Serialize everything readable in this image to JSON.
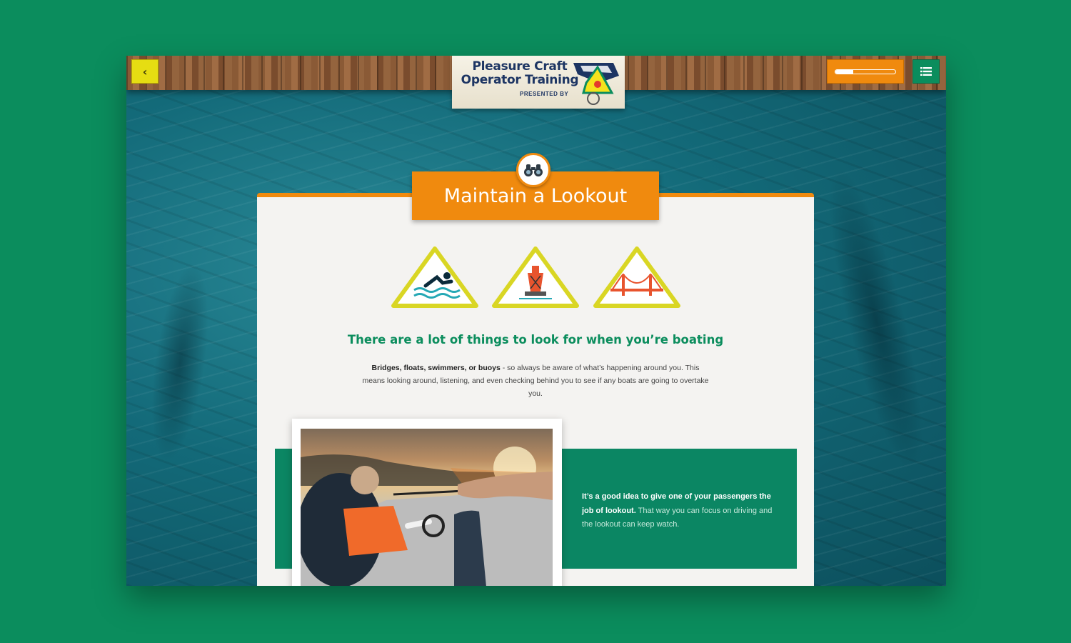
{
  "header": {
    "back_button": "‹",
    "logo_title_line1": "Pleasure Craft",
    "logo_title_line2": "Operator Training",
    "logo_presented_by": "PRESENTED BY",
    "progress": 0.3
  },
  "lesson": {
    "title": "Maintain a Lookout",
    "title_icon": "binoculars-icon",
    "signs": [
      "swimmer-sign-icon",
      "buoy-sign-icon",
      "bridge-sign-icon"
    ],
    "headline": "There are a lot of things to look for when you’re boating",
    "body_bold": "Bridges, floats, swimmers, or buoys",
    "body_rest": " -  so always be aware of what’s happening around you. This means looking around, listening, and even checking behind you to see if any boats are going to overtake you.",
    "panel_bold": "It’s a good idea to give one of your passengers the job of lookout.",
    "panel_rest": " That way you can focus on driving and the lookout can keep watch."
  },
  "colors": {
    "brand_green": "#0b8d5d",
    "accent_orange": "#f08a0e",
    "back_yellow": "#e6dd12"
  }
}
